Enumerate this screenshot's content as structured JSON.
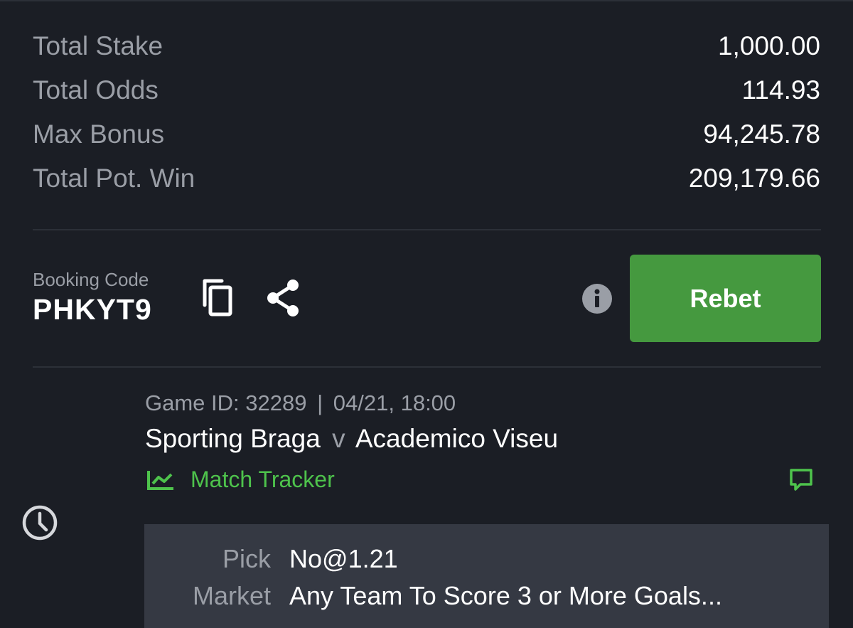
{
  "summary": {
    "rows": [
      {
        "label": "Total Stake",
        "value": "1,000.00"
      },
      {
        "label": "Total Odds",
        "value": "114.93"
      },
      {
        "label": "Max Bonus",
        "value": "94,245.78"
      },
      {
        "label": "Total Pot. Win",
        "value": "209,179.66"
      }
    ]
  },
  "booking": {
    "label": "Booking Code",
    "code": "PHKYT9"
  },
  "actions": {
    "copy_icon": "copy-icon",
    "share_icon": "share-icon",
    "info_icon": "info-icon",
    "rebet_label": "Rebet"
  },
  "game": {
    "status_icon": "clock-icon",
    "meta_id": "Game ID: 32289",
    "meta_sep": "|",
    "meta_time": "04/21, 18:00",
    "home": "Sporting Braga",
    "vs": "v",
    "away": "Academico Viseu",
    "tracker_label": "Match Tracker",
    "tracker_icon": "line-chart-icon",
    "comment_icon": "comment-icon"
  },
  "selection": {
    "pick_label": "Pick",
    "pick_value": "No@1.21",
    "market_label": "Market",
    "market_value": "Any Team To Score 3 or More Goals..."
  },
  "colors": {
    "background": "#1b1e25",
    "accent_green": "#45993f",
    "tracker_green": "#4ec34c",
    "card_background": "#353943",
    "muted_text": "#9a9ea6"
  }
}
